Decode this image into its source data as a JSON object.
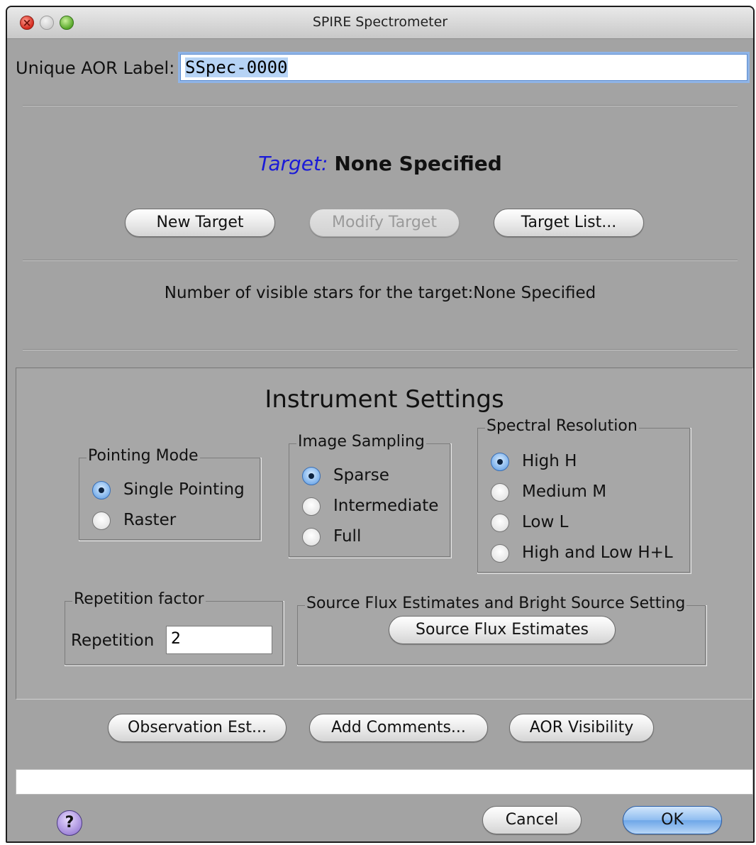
{
  "window": {
    "title": "SPIRE Spectrometer"
  },
  "aor": {
    "label": "Unique AOR Label:",
    "value": "SSpec-0000"
  },
  "target": {
    "prefix": "Target:",
    "value": "None Specified",
    "buttons": {
      "new": "New Target",
      "modify": "Modify Target",
      "list": "Target List..."
    },
    "visible_stars": "Number of visible stars for the target:None Specified"
  },
  "instrument": {
    "title": "Instrument Settings",
    "pointing_mode": {
      "title": "Pointing Mode",
      "options": [
        "Single Pointing",
        "Raster"
      ],
      "selected": "Single Pointing"
    },
    "image_sampling": {
      "title": "Image Sampling",
      "options": [
        "Sparse",
        "Intermediate",
        "Full"
      ],
      "selected": "Sparse"
    },
    "spectral_resolution": {
      "title": "Spectral Resolution",
      "options": [
        "High H",
        "Medium M",
        "Low L",
        "High and Low H+L"
      ],
      "selected": "High H"
    },
    "repetition": {
      "title": "Repetition factor",
      "label": "Repetition",
      "value": "2"
    },
    "source_flux": {
      "title": "Source Flux Estimates and Bright Source Setting",
      "button": "Source Flux Estimates"
    }
  },
  "actions": {
    "observation": "Observation Est...",
    "comments": "Add Comments...",
    "visibility": "AOR Visibility"
  },
  "status": {
    "message": ""
  },
  "footer": {
    "help": "?",
    "cancel": "Cancel",
    "ok": "OK"
  },
  "colors": {
    "window_bg": "#a3a3a3",
    "target_prefix": "#1a1ad8",
    "radio_selected": "#6fa8e8",
    "ok_button": "#8fbdf0"
  }
}
